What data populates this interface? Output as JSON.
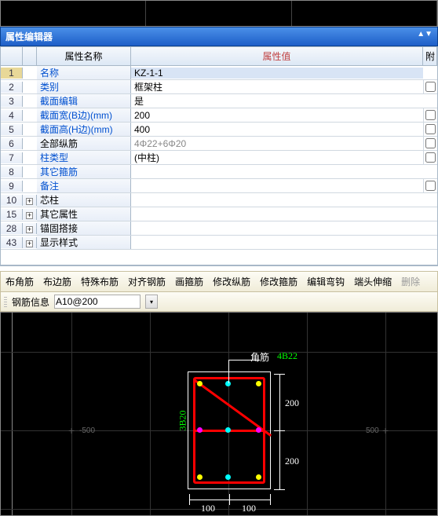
{
  "window": {
    "title": "属性编辑器"
  },
  "grid": {
    "head": {
      "name": "属性名称",
      "value": "属性值",
      "extra": "附"
    },
    "rows": [
      {
        "n": "1",
        "name": "名称",
        "val": "KZ-1-1",
        "blue": true,
        "sel": true
      },
      {
        "n": "2",
        "name": "类别",
        "val": "框架柱",
        "blue": true,
        "cb": true
      },
      {
        "n": "3",
        "name": "截面编辑",
        "val": "是",
        "blue": true
      },
      {
        "n": "4",
        "name": "截面宽(B边)(mm)",
        "val": "200",
        "blue": true,
        "cb": true
      },
      {
        "n": "5",
        "name": "截面高(H边)(mm)",
        "val": "400",
        "blue": true,
        "cb": true
      },
      {
        "n": "6",
        "name": "全部纵筋",
        "val": "4Φ22+6Φ20",
        "gray": true,
        "cb": true
      },
      {
        "n": "7",
        "name": "柱类型",
        "val": "(中柱)",
        "blue": true,
        "cb": true
      },
      {
        "n": "8",
        "name": "其它箍筋",
        "val": "",
        "blue": true
      },
      {
        "n": "9",
        "name": "备注",
        "val": "",
        "blue": true,
        "cb": true
      },
      {
        "n": "10",
        "name": "芯柱",
        "exp": true
      },
      {
        "n": "15",
        "name": "其它属性",
        "exp": true
      },
      {
        "n": "28",
        "name": "锚固搭接",
        "exp": true
      },
      {
        "n": "43",
        "name": "显示样式",
        "exp": true
      }
    ]
  },
  "toolbar": {
    "items": [
      "布角筋",
      "布边筋",
      "特殊布筋",
      "对齐钢筋",
      "画箍筋",
      "修改纵筋",
      "修改箍筋",
      "编辑弯钩",
      "端头伸缩"
    ],
    "disabled": "删除"
  },
  "rebar_info": {
    "label": "钢筋信息",
    "value": "A10@200"
  },
  "cad": {
    "axis_neg": "-500",
    "axis_pos": "500",
    "corner_label": "角筋",
    "corner_spec": "4B22",
    "side_spec": "3B20",
    "dim_h": "100",
    "dim_v": "200"
  }
}
